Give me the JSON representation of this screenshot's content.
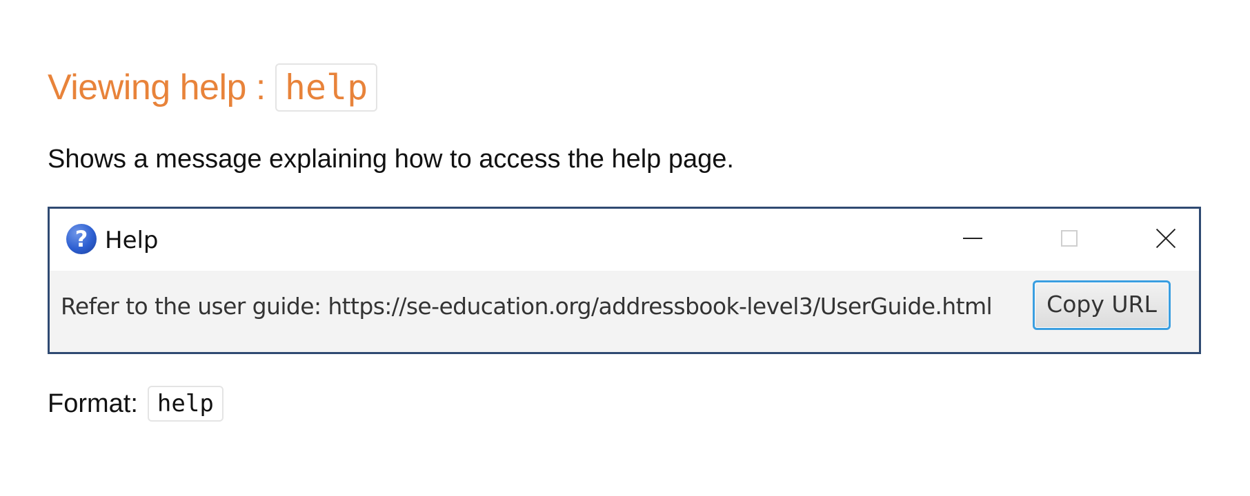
{
  "section": {
    "heading_text": "Viewing help :",
    "heading_code": "help",
    "description": "Shows a message explaining how to access the help page."
  },
  "help_window": {
    "title": "Help",
    "title_icon": "question-mark-icon",
    "icon_glyph": "?",
    "controls": [
      "minimize-icon",
      "maximize-icon",
      "close-icon"
    ],
    "message": "Refer to the user guide: https://se-education.org/addressbook-level3/UserGuide.html",
    "copy_button_label": "Copy URL",
    "colors": {
      "frame_border": "#2f4a72",
      "button_focus": "#3a9ee0",
      "content_bg": "#f3f3f3"
    }
  },
  "format": {
    "label": "Format:",
    "code": "help"
  },
  "colors": {
    "heading": "#e8833a",
    "text": "#111111"
  }
}
